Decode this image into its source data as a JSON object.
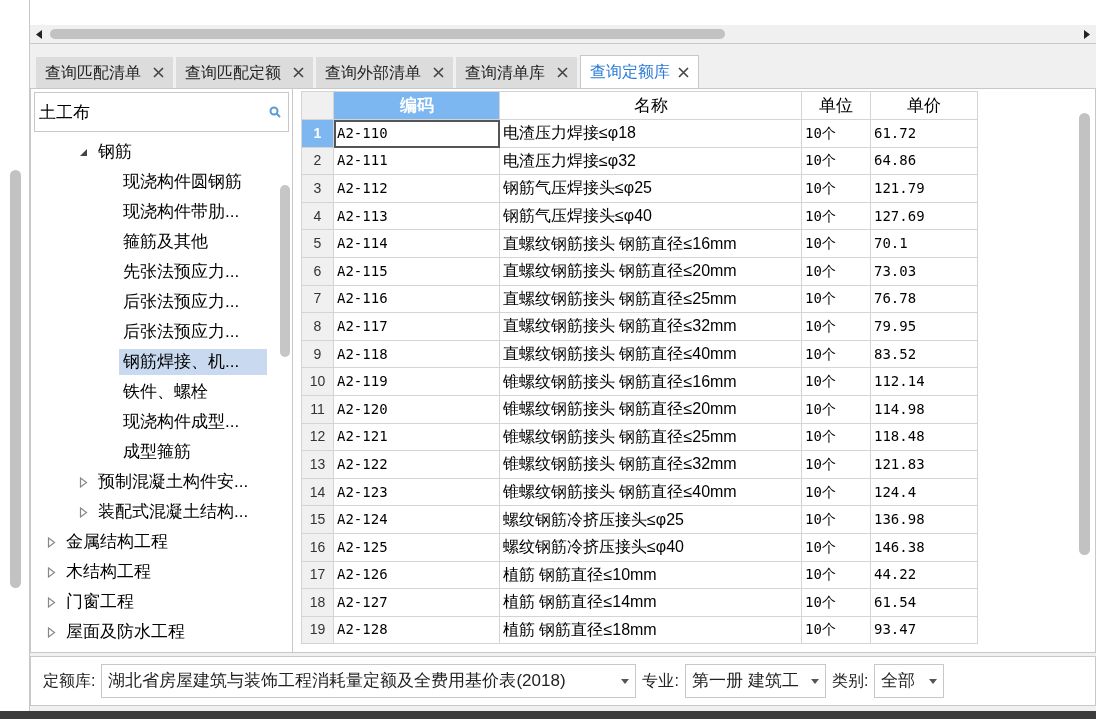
{
  "tabs": [
    {
      "label": "查询匹配清单",
      "selected": false
    },
    {
      "label": "查询匹配定额",
      "selected": false
    },
    {
      "label": "查询外部清单",
      "selected": false
    },
    {
      "label": "查询清单库",
      "selected": false
    },
    {
      "label": "查询定额库",
      "selected": true
    }
  ],
  "search": {
    "value": "土工布"
  },
  "tree": {
    "items": [
      {
        "children": [
          {
            "label": "钢筋",
            "expanded": true,
            "selected": false,
            "children": [
              {
                "label": "现浇构件圆钢筋",
                "selected": false
              },
              {
                "label": "现浇构件带肋...",
                "selected": false
              },
              {
                "label": "箍筋及其他",
                "selected": false
              },
              {
                "label": "先张法预应力...",
                "selected": false
              },
              {
                "label": "后张法预应力...",
                "selected": false
              },
              {
                "label": "后张法预应力...",
                "selected": false
              },
              {
                "label": "钢筋焊接、机...",
                "selected": true
              },
              {
                "label": "铁件、螺栓",
                "selected": false
              },
              {
                "label": "现浇构件成型...",
                "selected": false
              },
              {
                "label": "成型箍筋",
                "selected": false
              }
            ]
          },
          {
            "label": "预制混凝土构件安...",
            "expanded": false,
            "selected": false
          },
          {
            "label": "装配式混凝土结构...",
            "expanded": false,
            "selected": false
          }
        ]
      },
      {
        "label": "金属结构工程",
        "expanded": false,
        "selected": false
      },
      {
        "label": "木结构工程",
        "expanded": false,
        "selected": false
      },
      {
        "label": "门窗工程",
        "expanded": false,
        "selected": false
      },
      {
        "label": "屋面及防水工程",
        "expanded": false,
        "selected": false
      }
    ]
  },
  "table": {
    "columns": [
      {
        "label": "编码",
        "selected": true
      },
      {
        "label": "名称",
        "selected": false
      },
      {
        "label": "单位",
        "selected": false
      },
      {
        "label": "单价",
        "selected": false
      }
    ],
    "rows": [
      {
        "n": "1",
        "selected": true,
        "cells": [
          "A2-110",
          "电渣压力焊接≤φ18",
          "10个",
          "61.72"
        ]
      },
      {
        "n": "2",
        "selected": false,
        "cells": [
          "A2-111",
          "电渣压力焊接≤φ32",
          "10个",
          "64.86"
        ]
      },
      {
        "n": "3",
        "selected": false,
        "cells": [
          "A2-112",
          "钢筋气压焊接头≤φ25",
          "10个",
          "121.79"
        ]
      },
      {
        "n": "4",
        "selected": false,
        "cells": [
          "A2-113",
          "钢筋气压焊接头≤φ40",
          "10个",
          "127.69"
        ]
      },
      {
        "n": "5",
        "selected": false,
        "cells": [
          "A2-114",
          "直螺纹钢筋接头 钢筋直径≤16mm",
          "10个",
          "70.1"
        ]
      },
      {
        "n": "6",
        "selected": false,
        "cells": [
          "A2-115",
          "直螺纹钢筋接头 钢筋直径≤20mm",
          "10个",
          "73.03"
        ]
      },
      {
        "n": "7",
        "selected": false,
        "cells": [
          "A2-116",
          "直螺纹钢筋接头 钢筋直径≤25mm",
          "10个",
          "76.78"
        ]
      },
      {
        "n": "8",
        "selected": false,
        "cells": [
          "A2-117",
          "直螺纹钢筋接头 钢筋直径≤32mm",
          "10个",
          "79.95"
        ]
      },
      {
        "n": "9",
        "selected": false,
        "cells": [
          "A2-118",
          "直螺纹钢筋接头 钢筋直径≤40mm",
          "10个",
          "83.52"
        ]
      },
      {
        "n": "10",
        "selected": false,
        "cells": [
          "A2-119",
          "锥螺纹钢筋接头 钢筋直径≤16mm",
          "10个",
          "112.14"
        ]
      },
      {
        "n": "11",
        "selected": false,
        "cells": [
          "A2-120",
          "锥螺纹钢筋接头 钢筋直径≤20mm",
          "10个",
          "114.98"
        ]
      },
      {
        "n": "12",
        "selected": false,
        "cells": [
          "A2-121",
          "锥螺纹钢筋接头 钢筋直径≤25mm",
          "10个",
          "118.48"
        ]
      },
      {
        "n": "13",
        "selected": false,
        "cells": [
          "A2-122",
          "锥螺纹钢筋接头 钢筋直径≤32mm",
          "10个",
          "121.83"
        ]
      },
      {
        "n": "14",
        "selected": false,
        "cells": [
          "A2-123",
          "锥螺纹钢筋接头 钢筋直径≤40mm",
          "10个",
          "124.4"
        ]
      },
      {
        "n": "15",
        "selected": false,
        "cells": [
          "A2-124",
          "螺纹钢筋冷挤压接头≤φ25",
          "10个",
          "136.98"
        ]
      },
      {
        "n": "16",
        "selected": false,
        "cells": [
          "A2-125",
          "螺纹钢筋冷挤压接头≤φ40",
          "10个",
          "146.38"
        ]
      },
      {
        "n": "17",
        "selected": false,
        "cells": [
          "A2-126",
          "植筋 钢筋直径≤10mm",
          "10个",
          "44.22"
        ]
      },
      {
        "n": "18",
        "selected": false,
        "cells": [
          "A2-127",
          "植筋 钢筋直径≤14mm",
          "10个",
          "61.54"
        ]
      },
      {
        "n": "19",
        "selected": false,
        "cells": [
          "A2-128",
          "植筋 钢筋直径≤18mm",
          "10个",
          "93.47"
        ]
      }
    ]
  },
  "filters": [
    {
      "label": "定额库:",
      "value": "湖北省房屋建筑与装饰工程消耗量定额及全费用基价表(2018)"
    },
    {
      "label": "专业:",
      "value": "第一册 建筑工"
    },
    {
      "label": "类别:",
      "value": "全部"
    }
  ]
}
